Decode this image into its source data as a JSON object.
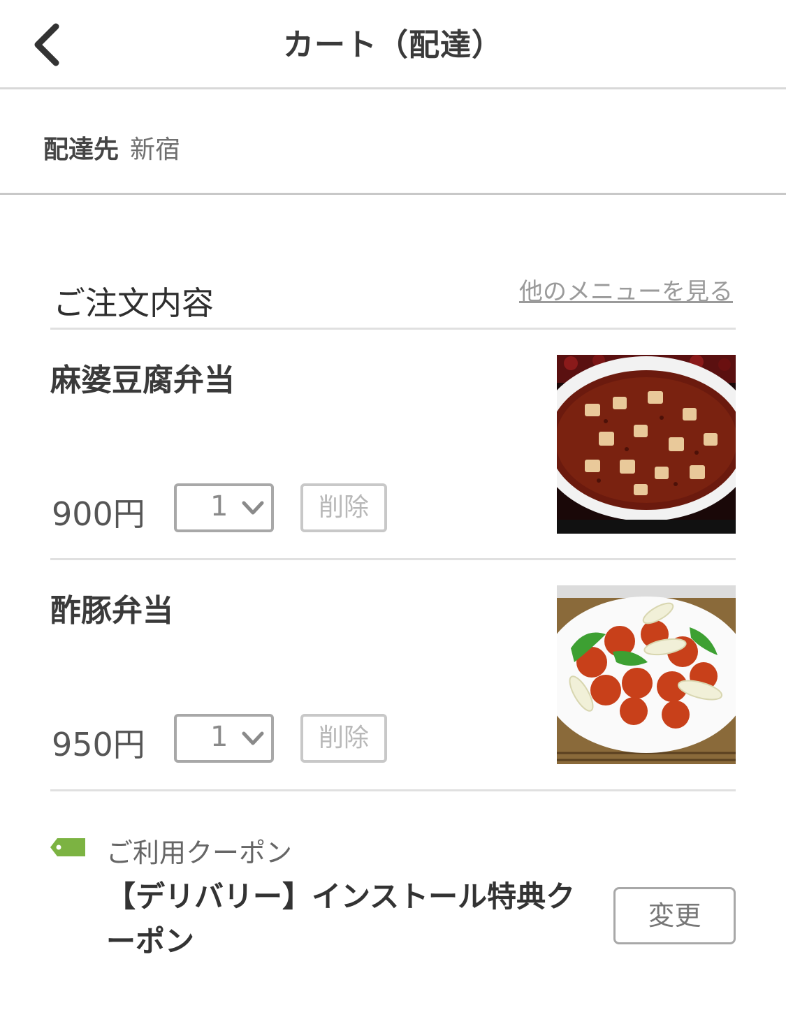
{
  "header": {
    "title": "カート（配達）",
    "back_icon": "chevron-left-icon"
  },
  "delivery": {
    "label": "配達先",
    "value": "新宿"
  },
  "order": {
    "section_title": "ご注文内容",
    "more_link": "他のメニューを見る",
    "items": [
      {
        "name": "麻婆豆腐弁当",
        "price": "900円",
        "quantity": "1",
        "delete_label": "削除",
        "image": "mapo-tofu-photo"
      },
      {
        "name": "酢豚弁当",
        "price": "950円",
        "quantity": "1",
        "delete_label": "削除",
        "image": "sweet-and-sour-pork-photo"
      }
    ]
  },
  "coupon": {
    "label": "ご利用クーポン",
    "name": "【デリバリー】インストール特典クーポン",
    "change_label": "変更",
    "icon": "coupon-tag-icon",
    "icon_color": "#7cb342"
  }
}
